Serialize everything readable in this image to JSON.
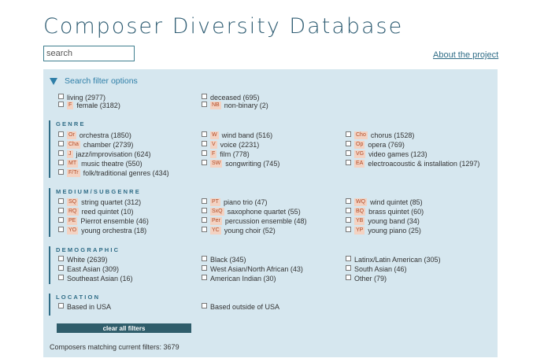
{
  "header": {
    "title": "Composer Diversity Database",
    "search_placeholder": "search",
    "about_link": "About the project"
  },
  "panel": {
    "toggle_label": "Search filter options",
    "status": [
      {
        "badge": "",
        "label": "living (2977)"
      },
      {
        "badge": "",
        "label": "deceased (695)"
      },
      {
        "badge": "F",
        "label": "female (3182)"
      },
      {
        "badge": "NB",
        "label": "non-binary (2)"
      }
    ],
    "genre": {
      "title": "GENRE",
      "items": [
        {
          "badge": "Or",
          "label": "orchestra (1850)"
        },
        {
          "badge": "W",
          "label": "wind band (516)"
        },
        {
          "badge": "Cho",
          "label": "chorus (1528)"
        },
        {
          "badge": "Cha",
          "label": "chamber (2739)"
        },
        {
          "badge": "V",
          "label": "voice (2231)"
        },
        {
          "badge": "Op",
          "label": "opera (769)"
        },
        {
          "badge": "J",
          "label": "jazz/improvisation (624)"
        },
        {
          "badge": "F",
          "label": "film (778)"
        },
        {
          "badge": "VG",
          "label": "video games (123)"
        },
        {
          "badge": "MT",
          "label": "music theatre (550)"
        },
        {
          "badge": "SW",
          "label": "songwriting (745)"
        },
        {
          "badge": "EA",
          "label": "electroacoustic & installation (1297)"
        },
        {
          "badge": "F/Tr",
          "label": "folk/traditional genres (434)"
        }
      ]
    },
    "medium": {
      "title": "MEDIUM/SUBGENRE",
      "items": [
        {
          "badge": "SQ",
          "label": "string quartet (312)"
        },
        {
          "badge": "PT",
          "label": "piano trio (47)"
        },
        {
          "badge": "WQ",
          "label": "wind quintet (85)"
        },
        {
          "badge": "RQ",
          "label": "reed quintet (10)"
        },
        {
          "badge": "SxQ",
          "label": "saxophone quartet (55)"
        },
        {
          "badge": "BQ",
          "label": "brass quintet (60)"
        },
        {
          "badge": "PE",
          "label": "Pierrot ensemble (46)"
        },
        {
          "badge": "Per",
          "label": "percussion ensemble (48)"
        },
        {
          "badge": "YB",
          "label": "young band (34)"
        },
        {
          "badge": "YO",
          "label": "young orchestra (18)"
        },
        {
          "badge": "YC",
          "label": "young choir (52)"
        },
        {
          "badge": "YP",
          "label": "young piano (25)"
        }
      ]
    },
    "demographic": {
      "title": "DEMOGRAPHIC",
      "items": [
        {
          "badge": "",
          "label": "White (2639)"
        },
        {
          "badge": "",
          "label": "Black (345)"
        },
        {
          "badge": "",
          "label": "Latinx/Latin American (305)"
        },
        {
          "badge": "",
          "label": "East Asian (309)"
        },
        {
          "badge": "",
          "label": "West Asian/North African (43)"
        },
        {
          "badge": "",
          "label": "South Asian (46)"
        },
        {
          "badge": "",
          "label": "Southeast Asian (16)"
        },
        {
          "badge": "",
          "label": "American Indian (30)"
        },
        {
          "badge": "",
          "label": "Other (79)"
        }
      ]
    },
    "location": {
      "title": "LOCATION",
      "items": [
        {
          "badge": "",
          "label": "Based in USA"
        },
        {
          "badge": "",
          "label": "Based outside of USA"
        }
      ]
    },
    "clear_button": "clear all filters",
    "match_count": "Composers matching current filters: 3679"
  }
}
